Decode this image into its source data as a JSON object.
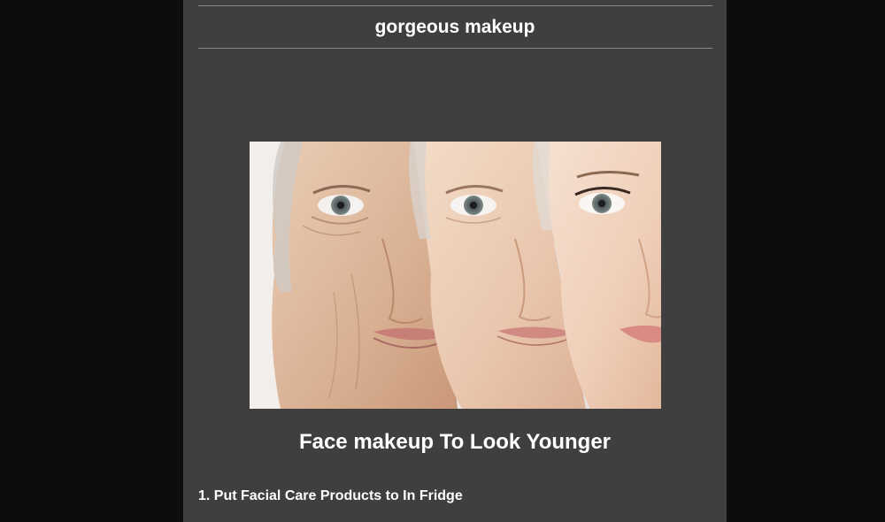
{
  "site": {
    "title": "gorgeous makeup"
  },
  "article": {
    "title": "Face makeup To Look Younger",
    "sections": [
      {
        "heading": "1. Put Facial Care Products to In Fridge"
      }
    ]
  }
}
